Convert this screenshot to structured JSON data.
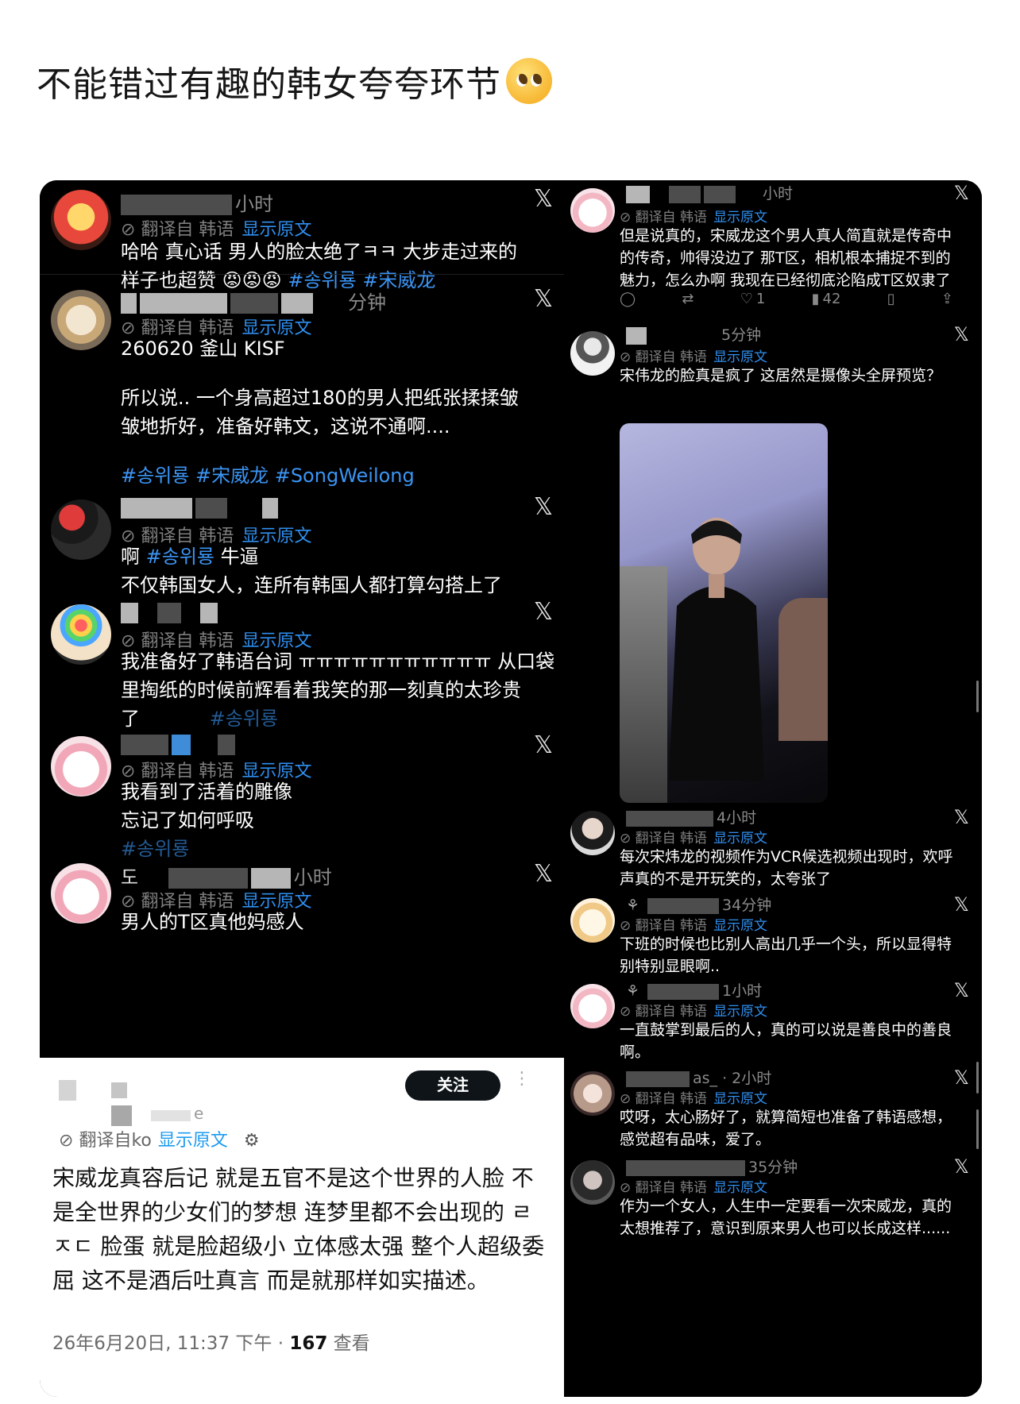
{
  "post": {
    "title": "不能错过有趣的韩女夸夸环节"
  },
  "icons": {
    "emoji": "pleading-face-icon",
    "x": "x-logo-icon",
    "reply": "reply-icon",
    "retweet": "retweet-icon",
    "like": "heart-icon",
    "views": "views-icon",
    "bookmark": "bookmark-icon",
    "share": "share-icon",
    "settings": "gear-icon"
  },
  "left": {
    "tweets": [
      {
        "time": "小时",
        "translated": "翻译自 韩语",
        "show_original": "显示原文",
        "line1": "哈哈 真心话 男人的脸太绝了ㅋㅋ 大步走过来的",
        "line2": "样子也超赞 ",
        "emoji": "😡😡😡",
        "tags": "#송위룡 #宋威龙"
      },
      {
        "time": "分钟",
        "translated": "翻译自 韩语",
        "show_original": "显示原文",
        "line1": "260620 釜山 KISF",
        "line2": "所以说.. 一个身高超过180的男人把纸张揉揉皱",
        "line3": "皱地折好，准备好韩文，这说不通啊....",
        "tags": "#송위룡 #宋威龙 #SongWeilong"
      },
      {
        "translated": "翻译自 韩语",
        "show_original": "显示原文",
        "line1_pre": "啊 ",
        "line1_tag": "#송위룡",
        "line1_post": " 牛逼",
        "line2": "不仅韩国女人，连所有韩国人都打算勾搭上了"
      },
      {
        "translated": "翻译自 韩语",
        "show_original": "显示原文",
        "line1": "我准备好了韩语台词 ㅠㅠㅠㅠㅠㅠㅠㅠㅠㅠㅠ 从口袋",
        "line2": "里掏纸的时候前辉看着我笑的那一刻真的太珍贵",
        "line3": "了",
        "tags": "#송위룡"
      },
      {
        "translated": "翻译自 韩语",
        "show_original": "显示原文",
        "line1": "我看到了活着的雕像",
        "line2": "忘记了如何呼吸",
        "tags": "#송위룡"
      },
      {
        "handle": "도",
        "time": "小时",
        "translated": "翻译自 韩语",
        "show_original": "显示原文",
        "line1": "男人的T区真他妈感人"
      }
    ]
  },
  "white_card": {
    "follow": "关注",
    "handle_suffix": "e",
    "translated": "翻译自ko",
    "show_original": "显示原文",
    "body": "宋威龙真容后记 就是五官不是这个世界的人脸 不是全世界的少女们的梦想 连梦里都不会出现的 ㄹㅈㄷ 脸蛋 就是脸超级小 立体感太强 整个人超级委屈 这不是酒后吐真言 而是就那样如实描述。",
    "date": "26年6月20日, 11:37 下午 · ",
    "views_count": "167",
    "views_label": " 查看"
  },
  "right": {
    "tweets": [
      {
        "time": "小时",
        "translated": "翻译自 韩语",
        "show_original": "显示原文",
        "body": "但是说真的，宋威龙这个男人真人简直就是传奇中的传奇，帅得没边了 那T区，相机根本捕捉不到的魅力，怎么办啊 我现在已经彻底沦陷成T区奴隶了",
        "likes": "1",
        "views": "42"
      },
      {
        "time": "5分钟",
        "translated": "翻译自 韩语",
        "show_original": "显示原文",
        "body": "宋伟龙的脸真是疯了 这居然是摄像头全屏预览？"
      },
      {
        "time": "4小时",
        "translated": "翻译自 韩语",
        "show_original": "显示原文",
        "body": "每次宋炜龙的视频作为VCR候选视频出现时，欢呼声真的不是开玩笑的，太夸张了"
      },
      {
        "time": "34分钟",
        "translated": "翻译自 韩语",
        "show_original": "显示原文",
        "body": "下班的时候也比别人高出几乎一个头，所以显得特别特别显眼啊.."
      },
      {
        "time": "1小时",
        "translated": "翻译自 韩语",
        "show_original": "显示原文",
        "body": "一直鼓掌到最后的人，真的可以说是善良中的善良啊。"
      },
      {
        "handle": "as_",
        "time": "2小时",
        "translated": "翻译自 韩语",
        "show_original": "显示原文",
        "body": "哎呀，太心肠好了，就算简短也准备了韩语感想，感觉超有品味，爱了。"
      },
      {
        "time": "35分钟",
        "translated": "翻译自 韩语",
        "show_original": "显示原文",
        "body": "作为一个女人，人生中一定要看一次宋威龙，真的太想推荐了，意识到原来男人也可以长成这样......"
      }
    ]
  }
}
